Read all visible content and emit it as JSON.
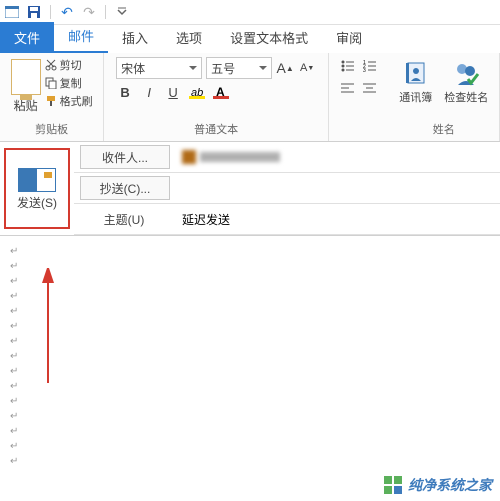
{
  "titlebar": {
    "undo": "↶",
    "redo": "↷"
  },
  "tabs": {
    "file": "文件",
    "mail": "邮件",
    "insert": "插入",
    "options": "选项",
    "format": "设置文本格式",
    "review": "审阅"
  },
  "ribbon": {
    "clipboard": {
      "label": "剪贴板",
      "paste": "粘贴",
      "cut": "剪切",
      "copy": "复制",
      "painter": "格式刷"
    },
    "font": {
      "label": "普通文本",
      "family": "宋体",
      "size": "五号"
    },
    "names": {
      "label": "姓名",
      "addressbook": "通讯簿",
      "checknames": "检查姓名"
    }
  },
  "compose": {
    "send": "发送(S)",
    "to_label": "收件人...",
    "cc_label": "抄送(C)...",
    "subject_label": "主题(U)",
    "subject_value": "延迟发送"
  },
  "watermark": "纯净系统之家"
}
